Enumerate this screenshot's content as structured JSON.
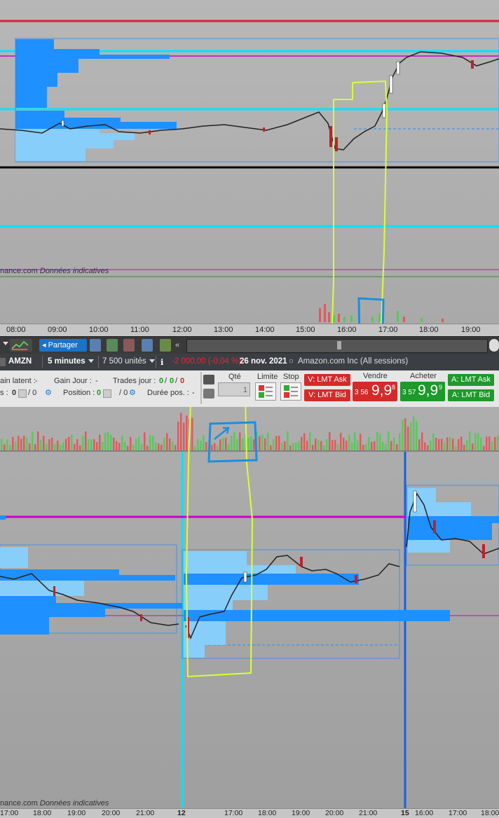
{
  "top_chart": {
    "source_label": "nance.com",
    "source_note": "Données indicatives",
    "time_ticks": [
      "08:00",
      "09:00",
      "10:00",
      "11:00",
      "12:00",
      "13:00",
      "14:00",
      "15:00",
      "16:00",
      "17:00",
      "18:00",
      "19:00"
    ]
  },
  "toolbar": {
    "share_label": "Partager",
    "scroll_left": "«"
  },
  "instrument_bar": {
    "symbol": "AMZN",
    "timeframe": "5 minutes",
    "units": "7 500 unités",
    "change": "-2 000,00 (-0,04 %)",
    "date": "26 nov. 2021",
    "description": "Amazon.com Inc (All sessions)"
  },
  "position_bar": {
    "latent_label": "ain latent :",
    "latent_value": "-",
    "day_gain_label": "Gain Jour :",
    "day_gain_value": "-",
    "trades_label": "Trades jour :",
    "trades_a": "0",
    "trades_b": "0",
    "trades_c": "0",
    "row2_prefix": "s :",
    "row2_a": "0",
    "row2_b": "/ 0",
    "position_label": "Position :",
    "position_a": "0",
    "position_b": "/ 0",
    "duration_label": "Durée pos. :",
    "duration_value": "-",
    "qty_label": "Qté",
    "qty_value": "1",
    "limit_label": "Limite",
    "stop_label": "Stop",
    "sell_header": "Vendre",
    "buy_header": "Acheter",
    "v_lmt_ask": "V: LMT Ask",
    "v_lmt_bid": "V: LMT Bid",
    "a_lmt_ask": "A: LMT Ask",
    "a_lmt_bid": "A: LMT Bid",
    "sell_small": "3 56",
    "sell_big": "9,9",
    "sell_sup": "8",
    "buy_small": "3 57",
    "buy_big": "9,9",
    "buy_sup": "9"
  },
  "bottom_chart": {
    "source_label": "nance.com",
    "source_note": "Données indicatives",
    "time_ticks": [
      "17:00",
      "18:00",
      "19:00",
      "20:00",
      "21:00",
      "12",
      "17:00",
      "18:00",
      "19:00",
      "20:00",
      "21:00",
      "15",
      "16:00",
      "17:00",
      "18:00"
    ]
  },
  "colors": {
    "profile_dark": "#1e90ff",
    "profile_light": "#87cefa",
    "cyan_line": "#00e5ff",
    "magenta_line": "#cc00cc",
    "red_line": "#e0203a",
    "annotation_yellow": "#d8ff3a",
    "annotation_blue": "#1a8fe0",
    "volume_green": "#5ac85a",
    "volume_red": "#e05a5a"
  }
}
